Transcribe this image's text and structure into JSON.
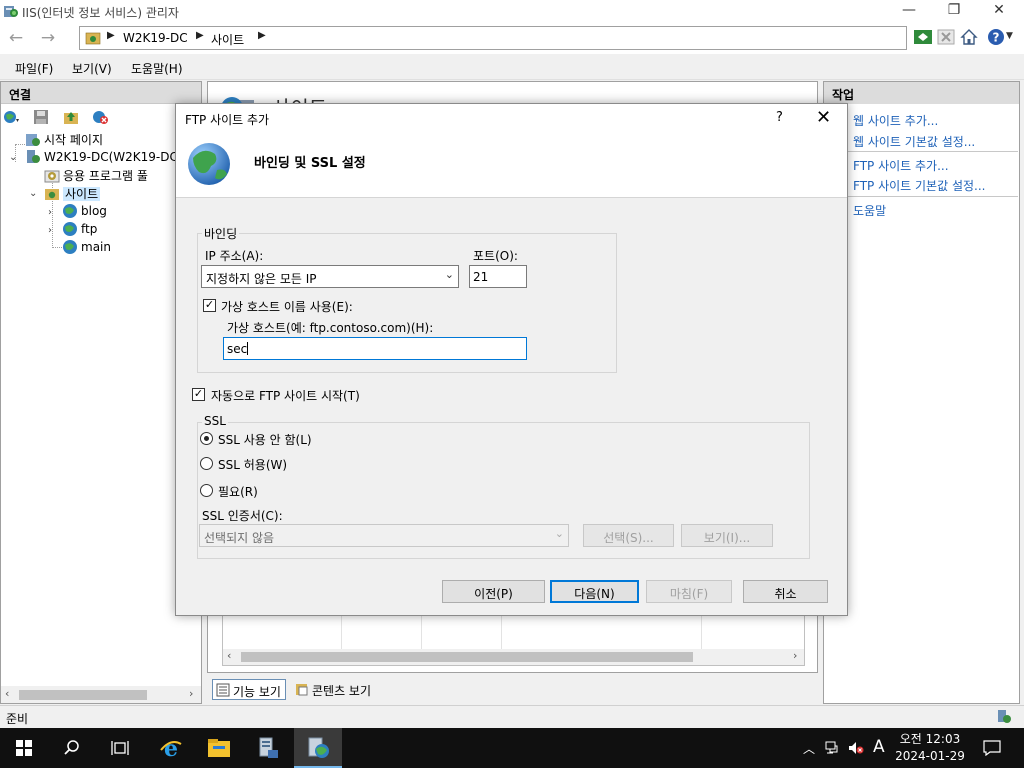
{
  "window": {
    "title": "IIS(인터넷 정보 서비스) 관리자",
    "minimize": "—",
    "restore": "❐",
    "close": "✕"
  },
  "nav": {
    "back": "←",
    "forward": "→",
    "breadcrumb": [
      "W2K19-DC",
      "사이트"
    ]
  },
  "menu": {
    "file": "파일(F)",
    "view": "보기(V)",
    "help": "도움말(H)"
  },
  "connections": {
    "header": "연결",
    "tree": {
      "start_page": "시작 페이지",
      "server": "W2K19-DC(W2K19-DC\\",
      "app_pools": "응용 프로그램 풀",
      "sites": "사이트",
      "site_blog": "blog",
      "site_ftp": "ftp",
      "site_main": "main"
    }
  },
  "center": {
    "heading": "사이트",
    "features_view": "기능 보기",
    "content_view": "콘텐츠 보기"
  },
  "actions": {
    "header": "작업",
    "add_web_site": "웹 사이트 추가...",
    "web_site_defaults": "웹 사이트 기본값 설정...",
    "add_ftp_site": "FTP 사이트 추가...",
    "ftp_site_defaults": "FTP 사이트 기본값 설정...",
    "help": "도움말"
  },
  "status": {
    "text": "준비"
  },
  "taskbar": {
    "time": "오전 12:03",
    "date": "2024-01-29",
    "ime": "A"
  },
  "dialog": {
    "title": "FTP 사이트 추가",
    "help": "?",
    "close": "✕",
    "heading": "바인딩 및 SSL 설정",
    "binding": {
      "group_label": "바인딩",
      "ip_label": "IP 주소(A):",
      "ip_value": "지정하지 않은 모든 IP",
      "port_label": "포트(O):",
      "port_value": "21",
      "vhost_check_label": "가상 호스트 이름 사용(E):",
      "vhost_checked": true,
      "vhost_label": "가상 호스트(예: ftp.contoso.com)(H):",
      "vhost_value": "sec"
    },
    "autostart_label": "자동으로 FTP 사이트 시작(T)",
    "autostart_checked": true,
    "ssl": {
      "group_label": "SSL",
      "no_ssl": "SSL 사용 안 함(L)",
      "allow_ssl": "SSL 허용(W)",
      "require_ssl": "필요(R)",
      "selected": "no_ssl",
      "cert_label": "SSL 인증서(C):",
      "cert_value": "선택되지 않음",
      "select_button": "선택(S)...",
      "view_button": "보기(I)..."
    },
    "buttons": {
      "previous": "이전(P)",
      "next": "다음(N)",
      "finish": "마침(F)",
      "cancel": "취소"
    }
  }
}
